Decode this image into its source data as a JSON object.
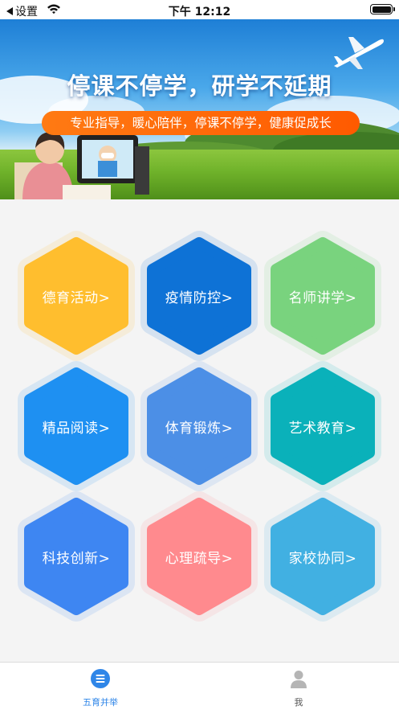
{
  "status_bar": {
    "back_label": "设置",
    "time": "下午 12:12"
  },
  "banner": {
    "title": "停课不停学，研学不延期",
    "subtitle": "专业指导，暖心陪伴，停课不停学，健康促成长"
  },
  "modules": [
    {
      "label": "德育活动>",
      "color": "#FFBE2E"
    },
    {
      "label": "疫情防控>",
      "color": "#0E72D6"
    },
    {
      "label": "名师讲学>",
      "color": "#79D37E"
    },
    {
      "label": "精品阅读>",
      "color": "#1E90F2"
    },
    {
      "label": "体育锻炼>",
      "color": "#4C8FE6"
    },
    {
      "label": "艺术教育>",
      "color": "#0AB1BA"
    },
    {
      "label": "科技创新>",
      "color": "#3E86F2"
    },
    {
      "label": "心理疏导>",
      "color": "#FF8A8E"
    },
    {
      "label": "家校协同>",
      "color": "#41B0E2"
    }
  ],
  "tab_bar": {
    "tabs": [
      {
        "label": "五育并举",
        "icon": "list-icon",
        "active": true
      },
      {
        "label": "我",
        "icon": "profile-icon",
        "active": false
      }
    ],
    "active_color": "#2F86E8",
    "inactive_color": "#555555"
  }
}
